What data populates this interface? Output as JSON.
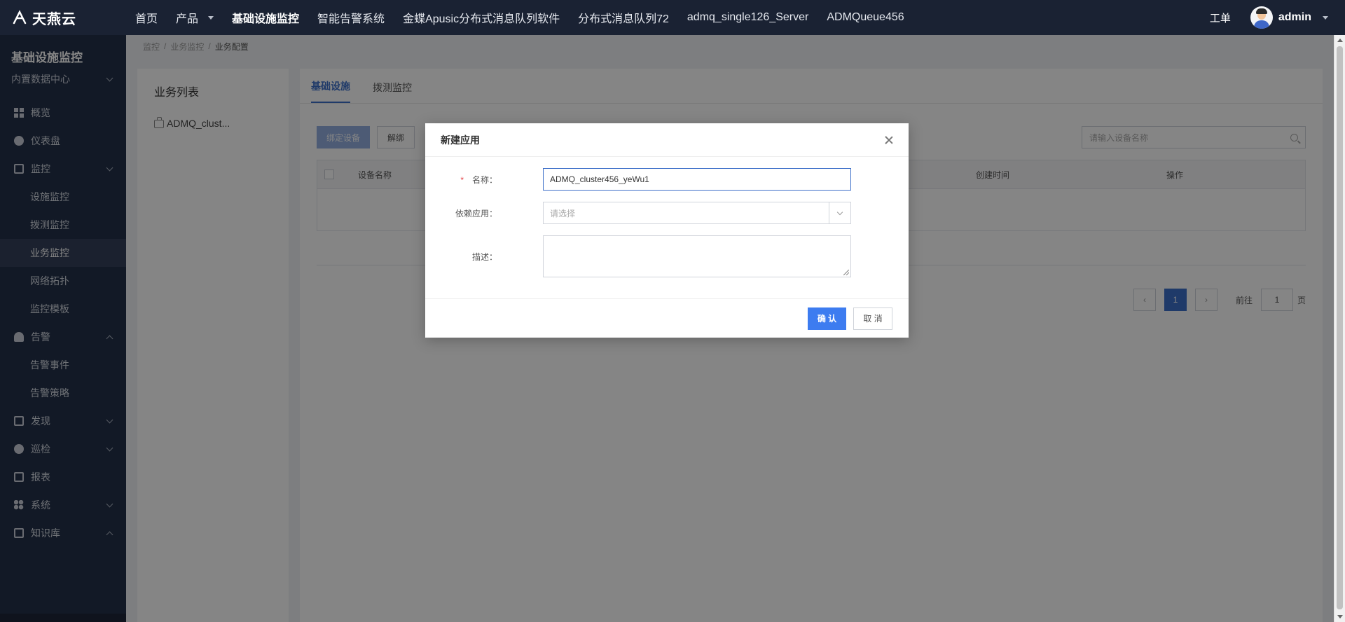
{
  "brand": {
    "name": "天燕云"
  },
  "topnav": {
    "items": [
      {
        "label": "首页"
      },
      {
        "label": "产品"
      },
      {
        "label": "基础设施监控"
      },
      {
        "label": "智能告警系统"
      },
      {
        "label": "金蝶Apusic分布式消息队列软件"
      },
      {
        "label": "分布式消息队列72"
      },
      {
        "label": "admq_single126_Server"
      },
      {
        "label": "ADMQueue456"
      }
    ],
    "ticket": "工单",
    "username": "admin"
  },
  "sidebar": {
    "title": "基础设施监控",
    "datacenter": "内置数据中心",
    "items": [
      {
        "label": "概览"
      },
      {
        "label": "仪表盘"
      },
      {
        "label": "监控"
      },
      {
        "label": "设施监控"
      },
      {
        "label": "拨测监控"
      },
      {
        "label": "业务监控"
      },
      {
        "label": "网络拓扑"
      },
      {
        "label": "监控模板"
      },
      {
        "label": "告警"
      },
      {
        "label": "告警事件"
      },
      {
        "label": "告警策略"
      },
      {
        "label": "发现"
      },
      {
        "label": "巡检"
      },
      {
        "label": "报表"
      },
      {
        "label": "系统"
      },
      {
        "label": "知识库"
      }
    ]
  },
  "breadcrumb": [
    "监控",
    "业务监控",
    "业务配置"
  ],
  "left_panel": {
    "title": "业务列表",
    "item": "ADMQ_clust..."
  },
  "tabs": [
    "基础设施",
    "拨测监控"
  ],
  "toolbar": {
    "bind_label": "绑定设备",
    "unbind_label": "解绑",
    "search_placeholder": "请输入设备名称"
  },
  "table": {
    "columns": [
      "设备名称",
      "创建时间",
      "操作"
    ]
  },
  "pagination": {
    "current": "1",
    "goto_label": "前往",
    "goto_value": "1",
    "page_label": "页"
  },
  "modal": {
    "title": "新建应用",
    "name_label": "名称：",
    "name_value": "ADMQ_cluster456_yeWu1",
    "dep_label": "依赖应用：",
    "dep_placeholder": "请选择",
    "desc_label": "描述：",
    "confirm_label": "确 认",
    "cancel_label": "取 消"
  }
}
